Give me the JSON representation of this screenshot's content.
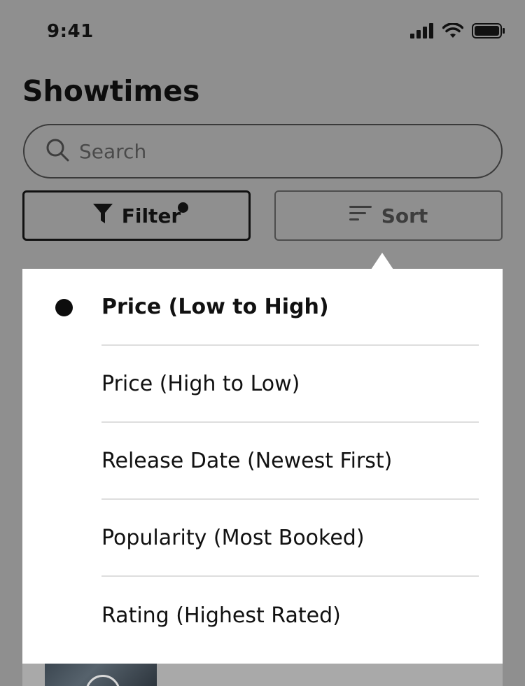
{
  "status_bar": {
    "time": "9:41"
  },
  "header": {
    "title": "Showtimes"
  },
  "search": {
    "placeholder": "Search"
  },
  "toolbar": {
    "filter_label": "Filter",
    "sort_label": "Sort",
    "filter_active": true
  },
  "sort_menu": {
    "selected_index": 0,
    "options": [
      {
        "label": "Price (Low to High)"
      },
      {
        "label": "Price (High to Low)"
      },
      {
        "label": "Release Date (Newest First)"
      },
      {
        "label": "Popularity (Most Booked)"
      },
      {
        "label": "Rating (Highest Rated)"
      }
    ]
  },
  "colors": {
    "overlay": "#8f8f8f",
    "menu_bg": "#ffffff",
    "text": "#111111"
  }
}
